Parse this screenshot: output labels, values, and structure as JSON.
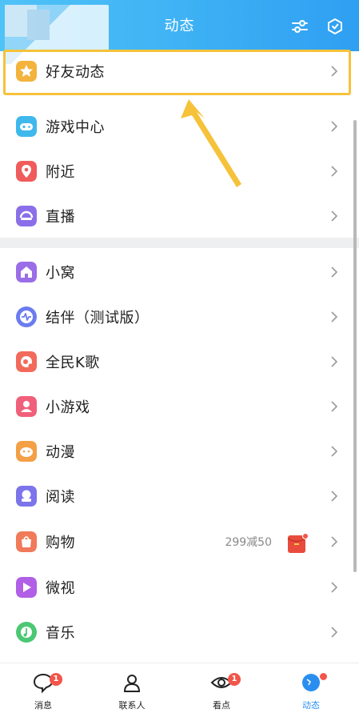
{
  "header": {
    "title": "动态",
    "filter_icon": "filter-sliders-icon",
    "settings_icon": "hexagon-settings-icon",
    "bg_color": "#40b4f5"
  },
  "menu_section_1": [
    {
      "label": "好友动态",
      "icon": "star-face-icon",
      "color": "#f3b33c"
    },
    {
      "label": "游戏中心",
      "icon": "gamepad-icon",
      "color": "#3fb8ec"
    },
    {
      "label": "附近",
      "icon": "location-pin-icon",
      "color": "#f05b5b"
    },
    {
      "label": "直播",
      "icon": "live-icon",
      "color": "#8b6fe8"
    }
  ],
  "menu_section_2": [
    {
      "label": "小窝",
      "icon": "home-icon",
      "color": "#9a6ee6"
    },
    {
      "label": "结伴（测试版）",
      "icon": "pulse-icon",
      "color": "#6b7cf0"
    },
    {
      "label": "全民K歌",
      "icon": "karaoke-icon",
      "color": "#f26a5b"
    },
    {
      "label": "小游戏",
      "icon": "mini-game-icon",
      "color": "#f0607a"
    },
    {
      "label": "动漫",
      "icon": "comic-icon",
      "color": "#f3a046"
    },
    {
      "label": "阅读",
      "icon": "reading-icon",
      "color": "#7b74ea"
    },
    {
      "label": "购物",
      "icon": "shopping-icon",
      "color": "#f07a5a",
      "promo": "299减50"
    },
    {
      "label": "微视",
      "icon": "weishi-icon",
      "color": "#b05fe6"
    },
    {
      "label": "音乐",
      "icon": "music-icon",
      "color": "#4cc774"
    }
  ],
  "tabs": [
    {
      "label": "消息",
      "icon": "message-icon",
      "badge": "1"
    },
    {
      "label": "联系人",
      "icon": "contacts-icon",
      "badge": ""
    },
    {
      "label": "看点",
      "icon": "eye-icon",
      "badge": "1"
    },
    {
      "label": "动态",
      "icon": "planet-icon",
      "badge": ""
    }
  ],
  "accent": "#f6c23a"
}
